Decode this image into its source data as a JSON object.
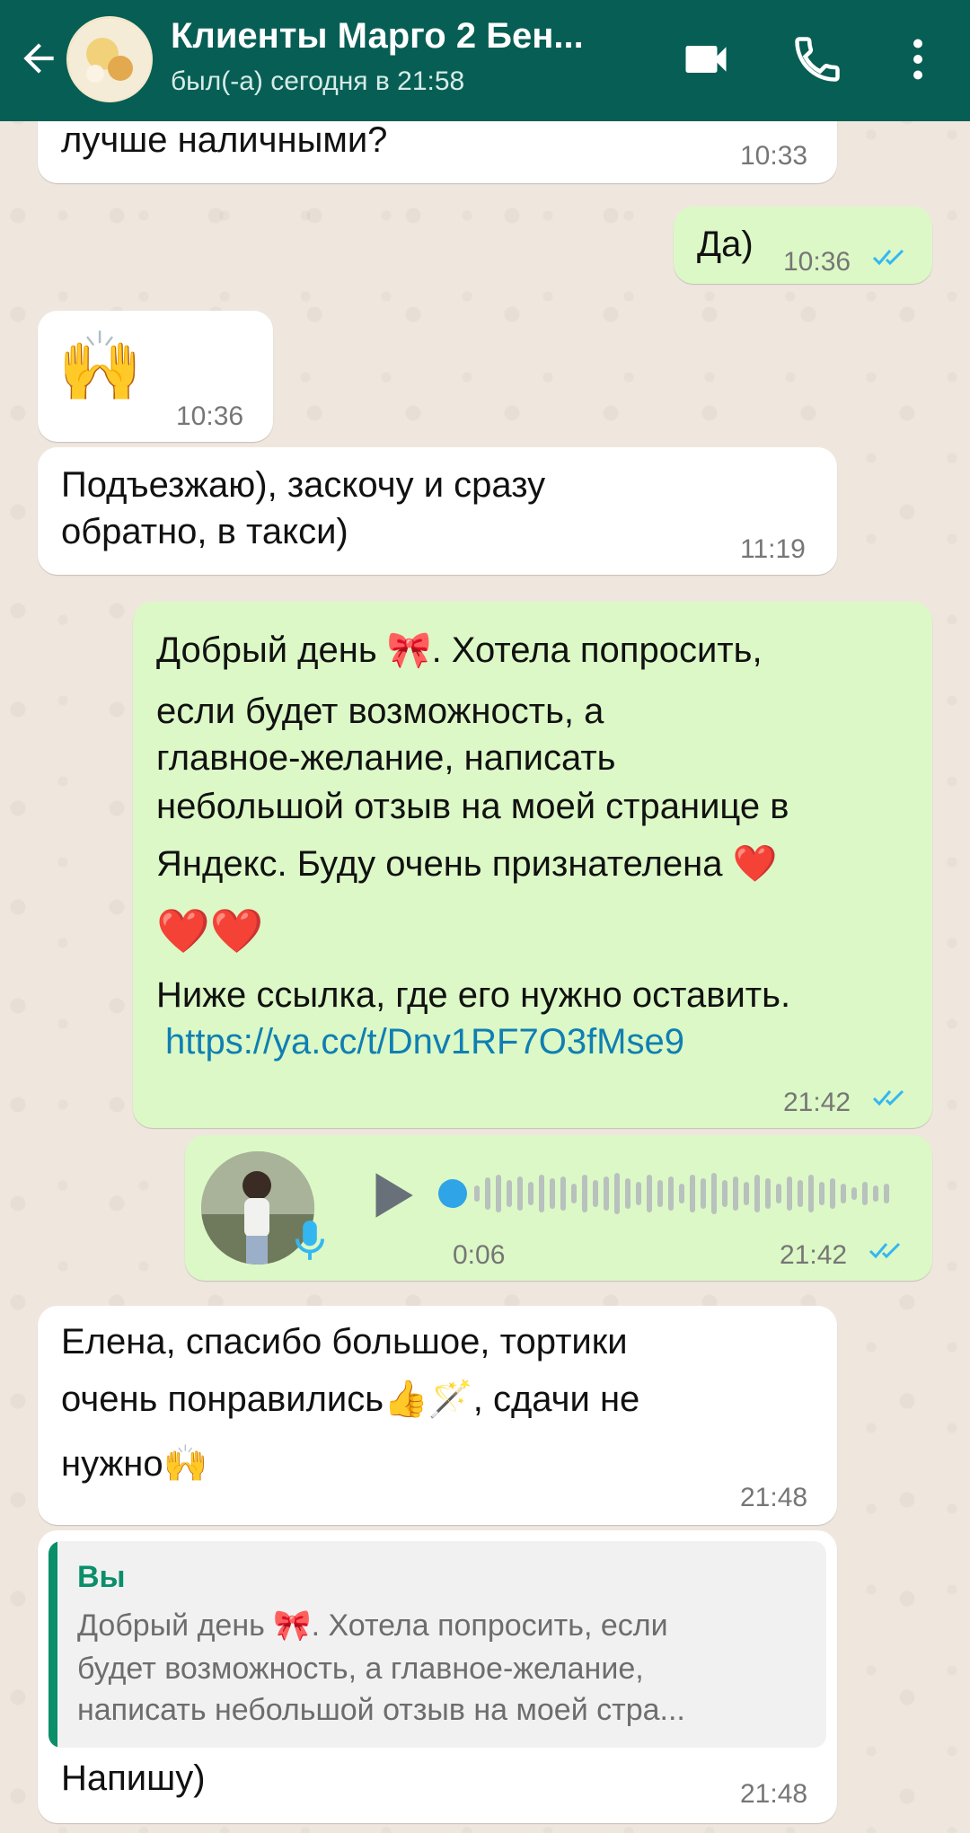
{
  "header": {
    "title": "Клиенты Марго 2 Бен...",
    "status": "был(-а) сегодня в 21:58"
  },
  "messages": [
    {
      "text": "лучше наличными?",
      "time": "10:33"
    },
    {
      "text": "Да)",
      "time": "10:36"
    },
    {
      "text": "🙌",
      "time": "10:36"
    },
    {
      "text_line1": "Подъезжаю), заскочу и сразу",
      "text_line2": "обратно, в такси)",
      "time": "11:19"
    },
    {
      "line1": "Добрый день 🎀.  Хотела попросить,",
      "line2": "если будет возможность,  а",
      "line3": "главное-желание,  написать",
      "line4": "небольшой отзыв на моей странице в",
      "line5": "Яндекс.  Буду очень признателена ❤️",
      "line6": "❤️❤️",
      "line7": "Ниже ссылка, где его нужно оставить.",
      "link": "https://ya.cc/t/Dnv1RF7O3fMse9",
      "time": "21:42"
    },
    {
      "duration": "0:06",
      "time": "21:42"
    },
    {
      "line1": "Елена, спасибо большое, тортики",
      "line2": "очень понравились👍🪄, сдачи не",
      "line3": "нужно🙌",
      "time": "21:48"
    },
    {
      "quote_author": "Вы",
      "quote_line1": "Добрый день 🎀.  Хотела попросить,  если",
      "quote_line2": "будет возможность,  а главное-желание,",
      "quote_line3": "написать небольшой отзыв на моей стра...",
      "text": "Напишу)",
      "time": "21:48"
    }
  ],
  "colors": {
    "header": "#075e54",
    "incoming": "#ffffff",
    "outgoing": "#dcf8c6",
    "tick": "#34b7f1",
    "link": "#0f7fb3",
    "quote_accent": "#0a8f6a"
  },
  "icons": {
    "back": "back-arrow-icon",
    "video": "video-call-icon",
    "phone": "phone-icon",
    "menu": "more-vert-icon",
    "play": "play-icon",
    "mic": "mic-icon",
    "read": "double-check-icon"
  }
}
